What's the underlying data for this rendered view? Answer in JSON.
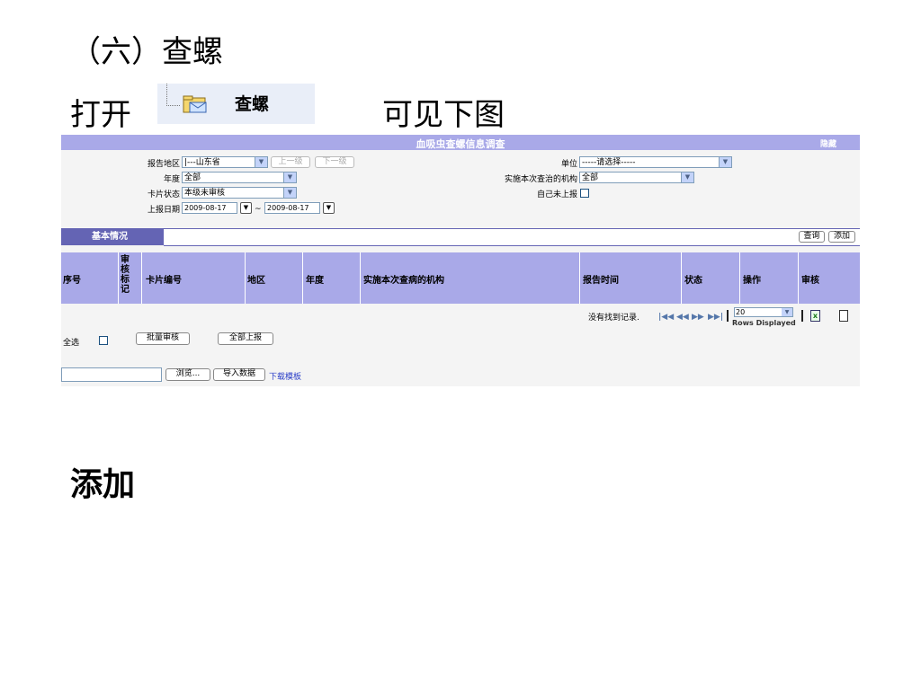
{
  "slide": {
    "title": "（六）查螺",
    "open_text": "打开",
    "menu_item_label": "查螺",
    "see_text": "可见下图",
    "add_heading": "添加"
  },
  "app": {
    "title": "血吸虫查螺信息调查",
    "hide_label": "隐藏",
    "form": {
      "report_area_label": "报告地区",
      "report_area_value": "|---山东省",
      "up_level_btn": "上一级",
      "down_level_btn": "下一级",
      "year_label": "年度",
      "year_value": "全部",
      "card_status_label": "卡片状态",
      "card_status_value": "本级未审核",
      "report_date_label": "上报日期",
      "date_from": "2009-08-17",
      "date_sep": "~",
      "date_to": "2009-08-17",
      "unit_label": "单位",
      "unit_value": "-----请选择-----",
      "institution_label": "实施本次查治的机构",
      "institution_value": "全部",
      "self_unreported_label": "自己未上报"
    },
    "tab": {
      "label": "基本情况",
      "query_btn": "查询",
      "add_btn": "添加"
    },
    "grid": {
      "columns": [
        "序号",
        "审核标记",
        "卡片编号",
        "地区",
        "年度",
        "实施本次查病的机构",
        "报告时间",
        "状态",
        "操作",
        "审核"
      ]
    },
    "pager": {
      "empty_text": "没有找到记录.",
      "rows_value": "20",
      "rows_label": "Rows Displayed"
    },
    "bottom": {
      "select_all_label": "全选",
      "batch_audit_btn": "批量审核",
      "report_all_btn": "全部上报",
      "browse_btn": "浏览...",
      "import_btn": "导入数据",
      "download_template_link": "下载模板"
    }
  }
}
